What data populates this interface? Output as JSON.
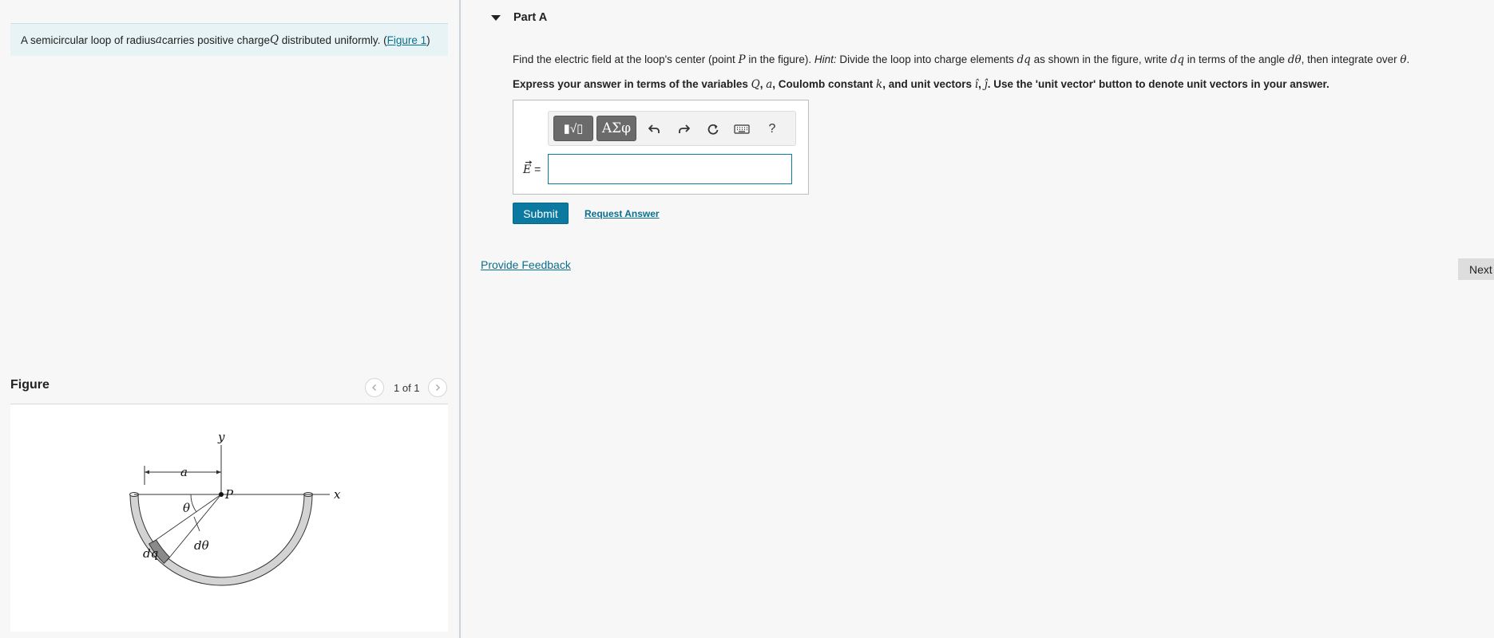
{
  "problem": {
    "text_before": "A semicircular loop of radius ",
    "var_a": "a",
    "text_mid": " carries positive charge ",
    "var_Q": "Q",
    "text_after": " distributed uniformly. (",
    "figure_link": "Figure 1",
    "text_close": ")"
  },
  "figure": {
    "title": "Figure",
    "counter": "1 of 1",
    "labels": {
      "y": "y",
      "x": "x",
      "a": "a",
      "P": "P",
      "theta": "θ",
      "dtheta": "dθ",
      "dq": "dq"
    }
  },
  "part": {
    "title": "Part A",
    "question": {
      "t1": "Find the electric field at the loop's center (point ",
      "v1": "P",
      "t2": " in the figure). ",
      "hint_label": "Hint:",
      "t3": " Divide the loop into charge elements ",
      "v2": "dq",
      "t4": " as shown in the figure, write ",
      "v3": "dq",
      "t5": " in terms of the angle ",
      "v4": "dθ",
      "t6": ", then integrate over ",
      "v5": "θ",
      "t7": "."
    },
    "instruction": {
      "t1": "Express your answer in terms of the variables ",
      "v1": "Q",
      "t2": ", ",
      "v2": "a",
      "t3": ", Coulomb constant ",
      "v3": "k",
      "t4": ", and unit vectors ",
      "v4": "î",
      "t5": ", ",
      "v5": "ĵ",
      "t6": ". Use the 'unit vector' button to denote unit vectors in your answer."
    }
  },
  "answer": {
    "label_var": "E",
    "label_eq": " =",
    "input_value": ""
  },
  "toolbar": {
    "templates_glyph": "▮√▯",
    "symbols_label": "ΑΣφ",
    "help_label": "?"
  },
  "actions": {
    "submit_label": "Submit",
    "request_answer_label": "Request Answer",
    "provide_feedback_label": "Provide Feedback",
    "next_label": "Next"
  },
  "colors": {
    "accent": "#0c7aa0",
    "link": "#0a6f8c",
    "problem_bg": "#e7f3f4",
    "toolbar_dark": "#6b6b6b"
  }
}
